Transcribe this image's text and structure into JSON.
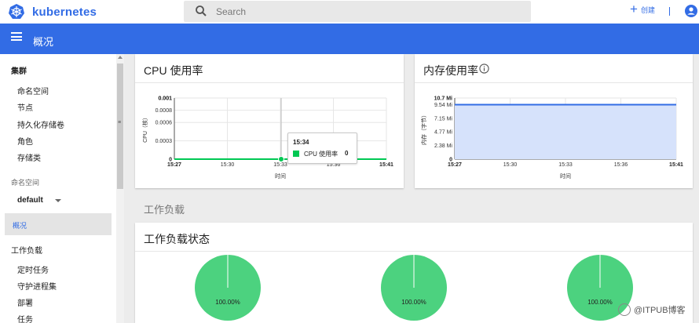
{
  "app": {
    "name": "kubernetes",
    "brand_color": "#326ce5"
  },
  "search": {
    "placeholder": "Search"
  },
  "header": {
    "create_label": "创建",
    "page_title": "概况"
  },
  "sidebar": {
    "cluster_label": "集群",
    "cluster_items": [
      "命名空间",
      "节点",
      "持久化存储卷",
      "角色",
      "存储类"
    ],
    "namespace_label": "命名空间",
    "namespace_value": "default",
    "overview_label": "概况",
    "workloads_label": "工作负载",
    "workload_items": [
      "定时任务",
      "守护进程集",
      "部署",
      "任务"
    ]
  },
  "cpu_card": {
    "title": "CPU 使用率"
  },
  "memory_card": {
    "title": "内存使用率"
  },
  "workloads_section": {
    "title": "工作负载"
  },
  "workload_status_card": {
    "title": "工作负载状态"
  },
  "tooltip": {
    "time": "15:34",
    "label": "CPU 使用率",
    "value": "0"
  },
  "watermark": {
    "text": "@ITPUB博客"
  },
  "chart_data": [
    {
      "type": "line",
      "title": "CPU 使用率",
      "xlabel": "时间",
      "ylabel": "CPU（核）",
      "x_ticks": [
        "15:27",
        "15:30",
        "15:33",
        "15:36",
        "15:41"
      ],
      "y_ticks": [
        "0",
        "0.0003",
        "0.0006",
        "0.0008",
        "0.001",
        "0.001"
      ],
      "series": [
        {
          "values": [
            0,
            0,
            0,
            0,
            0
          ],
          "color": "#00c853"
        }
      ],
      "ylim": [
        0,
        0.001
      ],
      "grid": true
    },
    {
      "type": "area",
      "title": "内存使用率",
      "xlabel": "时间",
      "ylabel": "内存（字节）",
      "x_ticks": [
        "15:27",
        "15:30",
        "15:33",
        "15:36",
        "15:41"
      ],
      "y_ticks": [
        "0",
        "2.38 Mi",
        "4.77 Mi",
        "7.15 Mi",
        "9.54 Mi",
        "10.7 Mi"
      ],
      "series": [
        {
          "values": [
            9.54,
            9.54,
            9.54,
            9.54,
            9.54
          ],
          "color": "#326ce5",
          "fill": "#d6e2fb"
        }
      ],
      "ylim": [
        0,
        10.7
      ],
      "grid": true
    },
    {
      "type": "pie",
      "slices": [
        {
          "label": "100.00%",
          "value": 100,
          "color": "#4cd27f"
        }
      ]
    },
    {
      "type": "pie",
      "slices": [
        {
          "label": "100.00%",
          "value": 100,
          "color": "#4cd27f"
        }
      ]
    },
    {
      "type": "pie",
      "slices": [
        {
          "label": "100.00%",
          "value": 100,
          "color": "#4cd27f"
        }
      ]
    }
  ]
}
